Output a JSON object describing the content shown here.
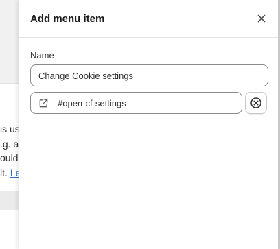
{
  "background": {
    "lines": [
      "is us",
      ".g. a",
      "ould",
      "lt."
    ],
    "link_text": "Le"
  },
  "drawer": {
    "title": "Add menu item",
    "close_icon": "close-icon",
    "name_label": "Name",
    "name_value": "Change Cookie settings",
    "link_value": "#open-cf-settings",
    "link_icon": "external-link-icon",
    "remove_icon": "circle-x-icon"
  }
}
